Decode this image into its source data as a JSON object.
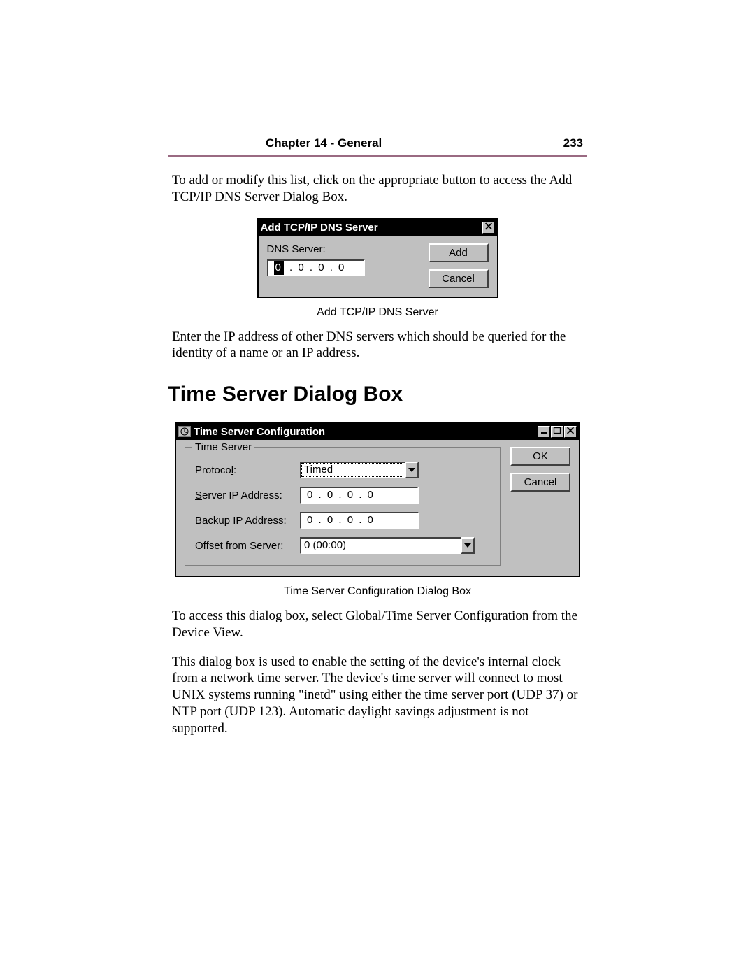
{
  "header": {
    "chapter": "Chapter 14 - General",
    "page": "233"
  },
  "intro": "To add or modify this list, click on the appropriate button to access the Add TCP/IP DNS Server Dialog Box.",
  "dns_dialog": {
    "title": "Add TCP/IP DNS Server",
    "label": "DNS Server:",
    "ip_first": "0",
    "ip_rest": " .  0  .  0  .  0",
    "add": "Add",
    "cancel": "Cancel"
  },
  "dns_caption": "Add TCP/IP DNS Server",
  "dns_desc": "Enter the IP address of other DNS servers which should be queried  for the identity of a name or an IP address.",
  "section_heading": "Time Server Dialog Box",
  "ts_dialog": {
    "title": "Time Server Configuration",
    "group": "Time Server",
    "protocol_label_pre": "Protoco",
    "protocol_label_ul": "l",
    "protocol_label_post": ":",
    "protocol_value": "Timed",
    "server_label_ul": "S",
    "server_label_post": "erver IP Address:",
    "server_ip": "0  .  0  .  0  .  0",
    "backup_label_ul": "B",
    "backup_label_post": "ackup IP Address:",
    "backup_ip": "0  .  0  .  0  .  0",
    "offset_label_ul": "O",
    "offset_label_post": "ffset from Server:",
    "offset_value": "0 (00:00)",
    "ok": "OK",
    "cancel": "Cancel"
  },
  "ts_caption": "Time Server Configuration Dialog Box",
  "ts_para1": "To access this dialog box, select Global/Time Server Configuration from the Device View.",
  "ts_para2": "This dialog box is used to enable the setting of the device's internal clock from a network time server. The device's time server will connect to most UNIX systems running \"inetd\" using either the time server port (UDP 37) or NTP port (UDP 123).  Automatic daylight savings adjustment is not supported."
}
